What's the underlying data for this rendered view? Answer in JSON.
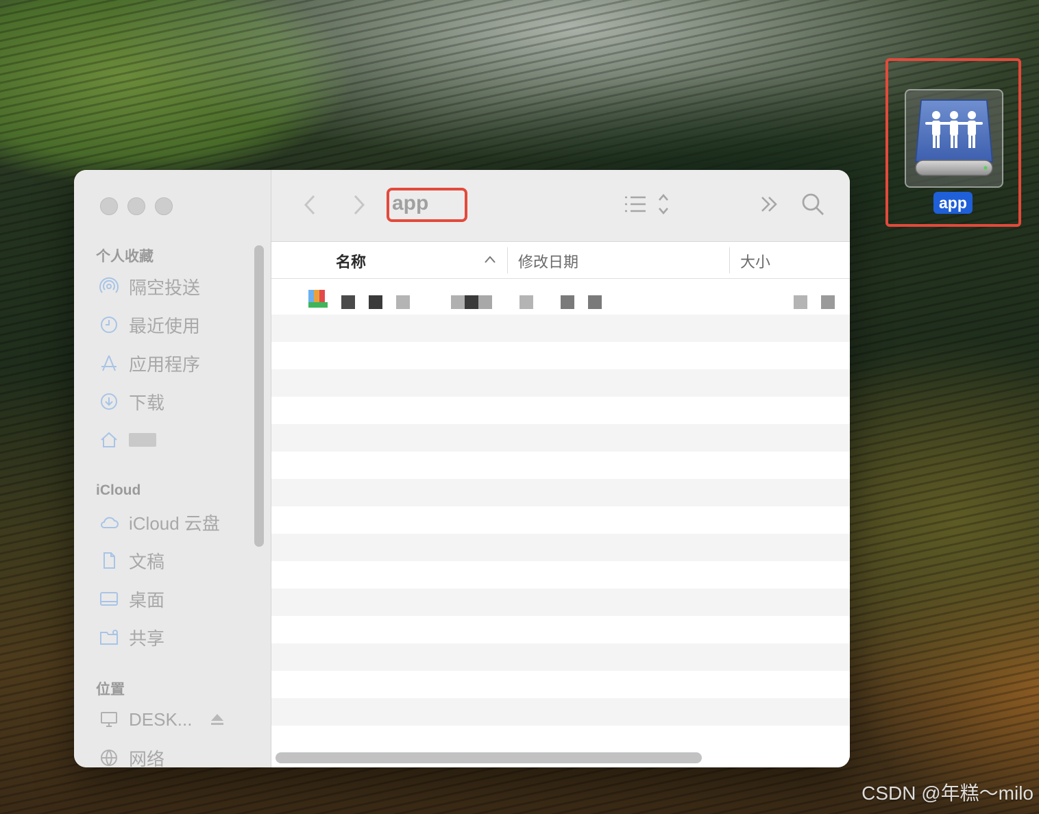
{
  "window": {
    "title": "app"
  },
  "sidebar": {
    "favorites_header": "个人收藏",
    "favorites": [
      {
        "label": "隔空投送",
        "icon": "airdrop-icon"
      },
      {
        "label": "最近使用",
        "icon": "clock-icon"
      },
      {
        "label": "应用程序",
        "icon": "applications-icon"
      },
      {
        "label": "下载",
        "icon": "download-icon"
      }
    ],
    "icloud_header": "iCloud",
    "icloud": [
      {
        "label": "iCloud 云盘",
        "icon": "cloud-icon"
      },
      {
        "label": "文稿",
        "icon": "document-icon"
      },
      {
        "label": "桌面",
        "icon": "desktop-icon"
      },
      {
        "label": "共享",
        "icon": "shared-folder-icon"
      }
    ],
    "locations_header": "位置",
    "locations": [
      {
        "label": "DESK...",
        "icon": "computer-icon"
      },
      {
        "label": "网络",
        "icon": "network-icon"
      }
    ]
  },
  "columns": {
    "name": "名称",
    "modified": "修改日期",
    "size": "大小"
  },
  "desktop": {
    "volume_label": "app"
  },
  "watermark": "CSDN @年糕～milo",
  "colors": {
    "highlight_red": "#e34a3b",
    "selection_blue": "#1f5fd8"
  }
}
